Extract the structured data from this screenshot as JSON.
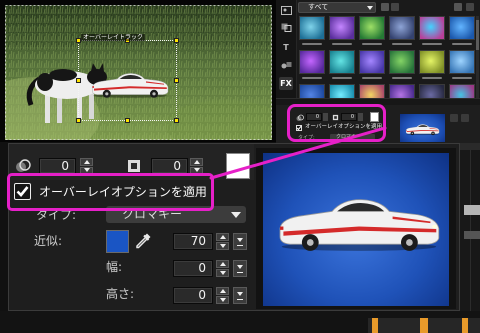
{
  "preview": {
    "overlay_label": "オーバーレイトラック"
  },
  "library": {
    "category": "すべて",
    "toolbar": {
      "title_label": "T",
      "fx_label": "FX",
      "icons": [
        "media-icon",
        "transition-icon",
        "title-icon",
        "graphic-icon",
        "filter-fx-icon"
      ]
    },
    "thumbnails": [
      {
        "colors": [
          "#1d6f96",
          "#7fd3ea"
        ]
      },
      {
        "colors": [
          "#5a2e9c",
          "#c486ff"
        ]
      },
      {
        "colors": [
          "#257a34",
          "#9ee067"
        ]
      },
      {
        "colors": [
          "#34426f",
          "#8ea4d6"
        ]
      },
      {
        "colors": [
          "#b8409a",
          "#44d2ff"
        ]
      },
      {
        "colors": [
          "#1b58ac",
          "#62b4ff"
        ]
      },
      {
        "colors": [
          "#54289a",
          "#c466ff"
        ]
      },
      {
        "colors": [
          "#17808f",
          "#64e4e4"
        ]
      },
      {
        "colors": [
          "#4636a6",
          "#a486ff"
        ]
      },
      {
        "colors": [
          "#26723a",
          "#84d466"
        ]
      },
      {
        "colors": [
          "#7e8e26",
          "#e4f466"
        ]
      },
      {
        "colors": [
          "#3574b4",
          "#9ed4ff"
        ]
      },
      {
        "colors": [
          "#1a469c",
          "#5484e4"
        ]
      },
      {
        "colors": [
          "#168bab",
          "#74ecff"
        ]
      },
      {
        "colors": [
          "#a84468",
          "#f2d464"
        ]
      },
      {
        "colors": [
          "#46288a",
          "#b474e4"
        ]
      },
      {
        "colors": [
          "#26283f",
          "#6a6aa2"
        ]
      },
      {
        "colors": [
          "#9a3886",
          "#44c4e4"
        ]
      }
    ]
  },
  "mini_options": {
    "transparency_value": "0",
    "border_value": "0",
    "apply_label": "オーバーレイオプションを適用",
    "type_label": "タイプ:",
    "type_value": "クロマキー"
  },
  "overlay_options": {
    "transparency_value": "0",
    "border_value": "0",
    "apply_label": "オーバーレイオプションを適用",
    "apply_checked": true,
    "type_label": "タイプ:",
    "type_value": "クロマキー",
    "similarity_label": "近似:",
    "similarity_value": "70",
    "width_label": "幅:",
    "width_value": "0",
    "height_label": "高さ:",
    "height_value": "0"
  },
  "colors": {
    "highlight": "#e620c8",
    "key_color": "#1a55c4",
    "border_color": "#ffffff",
    "clip_accent": "#e89a2a"
  }
}
